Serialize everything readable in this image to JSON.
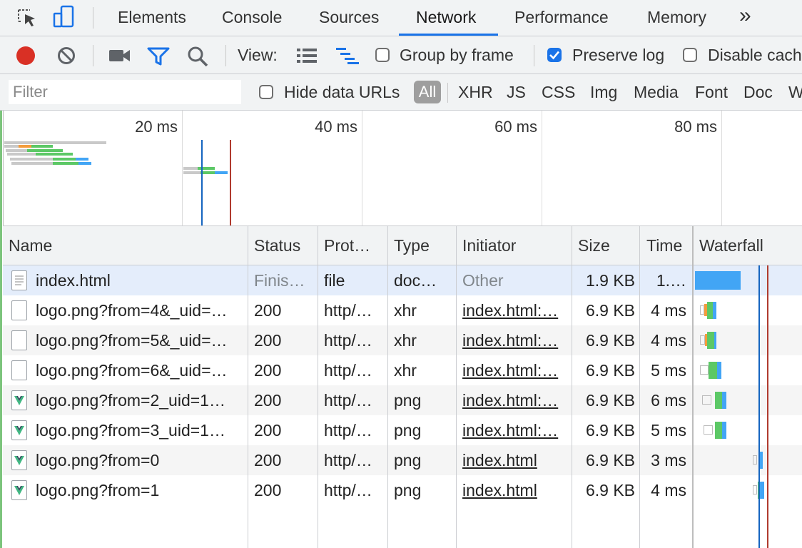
{
  "tabs": {
    "items": [
      "Elements",
      "Console",
      "Sources",
      "Network",
      "Performance",
      "Memory"
    ],
    "active": "Network",
    "more": "»"
  },
  "toolbar": {
    "view_label": "View:",
    "group_by_frame_label": "Group by frame",
    "group_by_frame_checked": false,
    "preserve_log_label": "Preserve log",
    "preserve_log_checked": true,
    "disable_cache_label": "Disable cach"
  },
  "filterbar": {
    "filter_placeholder": "Filter",
    "hide_data_urls_label": "Hide data URLs",
    "types": [
      "All",
      "XHR",
      "JS",
      "CSS",
      "Img",
      "Media",
      "Font",
      "Doc",
      "W"
    ],
    "active_type": "All"
  },
  "overview": {
    "ticks": [
      "20 ms",
      "40 ms",
      "60 ms",
      "80 ms"
    ]
  },
  "table": {
    "columns": [
      "Name",
      "Status",
      "Prot…",
      "Type",
      "Initiator",
      "Size",
      "Time",
      "Waterfall"
    ],
    "rows": [
      {
        "name": "index.html",
        "status": "Finis…",
        "protocol": "file",
        "type": "doc…",
        "initiator": "Other",
        "size": "1.9 KB",
        "time": "1.…",
        "icon": "document-icon"
      },
      {
        "name": "logo.png?from=4&_uid=…",
        "status": "200",
        "protocol": "http/…",
        "type": "xhr",
        "initiator": "index.html:…",
        "size": "6.9 KB",
        "time": "4 ms",
        "icon": "blank-file-icon"
      },
      {
        "name": "logo.png?from=5&_uid=…",
        "status": "200",
        "protocol": "http/…",
        "type": "xhr",
        "initiator": "index.html:…",
        "size": "6.9 KB",
        "time": "4 ms",
        "icon": "blank-file-icon"
      },
      {
        "name": "logo.png?from=6&_uid=…",
        "status": "200",
        "protocol": "http/…",
        "type": "xhr",
        "initiator": "index.html:…",
        "size": "6.9 KB",
        "time": "5 ms",
        "icon": "blank-file-icon"
      },
      {
        "name": "logo.png?from=2_uid=1…",
        "status": "200",
        "protocol": "http/…",
        "type": "png",
        "initiator": "index.html:…",
        "size": "6.9 KB",
        "time": "6 ms",
        "icon": "vue-logo-icon"
      },
      {
        "name": "logo.png?from=3_uid=1…",
        "status": "200",
        "protocol": "http/…",
        "type": "png",
        "initiator": "index.html:…",
        "size": "6.9 KB",
        "time": "5 ms",
        "icon": "vue-logo-icon"
      },
      {
        "name": "logo.png?from=0",
        "status": "200",
        "protocol": "http/…",
        "type": "png",
        "initiator": "index.html",
        "size": "6.9 KB",
        "time": "3 ms",
        "icon": "vue-logo-icon"
      },
      {
        "name": "logo.png?from=1",
        "status": "200",
        "protocol": "http/…",
        "type": "png",
        "initiator": "index.html",
        "size": "6.9 KB",
        "time": "4 ms",
        "icon": "vue-logo-icon"
      }
    ]
  },
  "colors": {
    "accent_blue": "#1a73e8",
    "record_red": "#d93025",
    "waiting_green": "#5cc866",
    "download_blue": "#42a5f5",
    "selected_row": "#e4edfb",
    "alt_row": "#f5f5f5",
    "dom_content_line": "#1565c0",
    "load_line": "#b03a2e"
  }
}
